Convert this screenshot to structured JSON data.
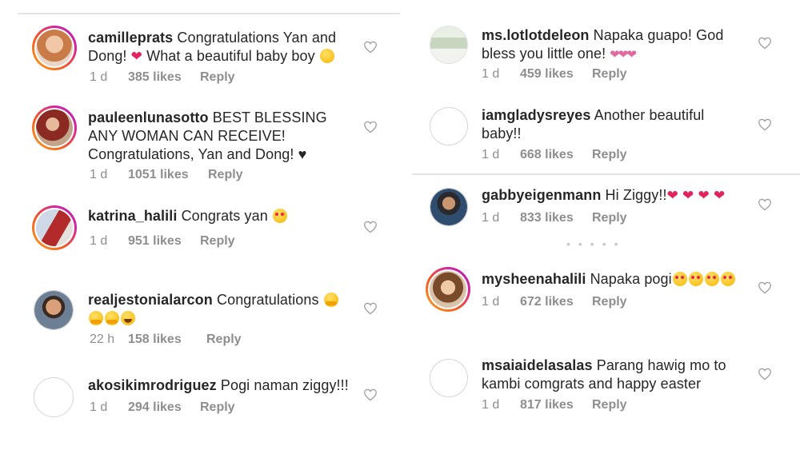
{
  "left": [
    {
      "username": "camilleprats",
      "lines": [
        "Congratulations Yan and",
        "Dong! ",
        "What a beautiful baby boy "
      ],
      "time": "1 d",
      "likes": "385 likes",
      "reply": "Reply"
    },
    {
      "username": "pauleenlunasotto",
      "lines": [
        "BEST BLESSING",
        "ANY WOMAN CAN RECEIVE!",
        "Congratulations, Yan and Dong! ♥"
      ],
      "time": "1 d",
      "likes": "1051 likes",
      "reply": "Reply"
    },
    {
      "username": "katrina_halili",
      "lines": [
        "Congrats yan "
      ],
      "time": "1 d",
      "likes": "951 likes",
      "reply": "Reply"
    },
    {
      "username": "realjestonialarcon",
      "lines": [
        "Congratulations "
      ],
      "time": "22 h",
      "likes": "158 likes",
      "reply": "Reply"
    },
    {
      "username": "akosikimrodriguez",
      "lines": [
        "Pogi naman ziggy!!!"
      ],
      "time": "1 d",
      "likes": "294 likes",
      "reply": "Reply"
    }
  ],
  "right": [
    {
      "username": "ms.lotlotdeleon",
      "lines": [
        "Napaka guapo! God",
        "bless you little one! "
      ],
      "time": "1 d",
      "likes": "459 likes",
      "reply": "Reply"
    },
    {
      "username": "iamgladysreyes",
      "lines": [
        "Another beautiful",
        "baby!!"
      ],
      "time": "1 d",
      "likes": "668 likes",
      "reply": "Reply"
    },
    {
      "username": "gabbyeigenmann",
      "lines": [
        "Hi Ziggy!!"
      ],
      "time": "1 d",
      "likes": "833 likes",
      "reply": "Reply"
    },
    {
      "username": "mysheenahalili",
      "lines": [
        "Napaka pogi"
      ],
      "time": "1 d",
      "likes": "672 likes",
      "reply": "Reply"
    },
    {
      "username": "msaiaidelasalas",
      "lines": [
        "Parang hawig mo to",
        "kambi comgrats and happy easter"
      ],
      "time": "1 d",
      "likes": "817 likes",
      "reply": "Reply"
    }
  ],
  "icons": {
    "like": "heart-outline-icon"
  },
  "colors": {
    "text": "#262626",
    "meta": "#8e8e8e",
    "heart": "#e0245e",
    "story_ring": "#d6249f"
  }
}
